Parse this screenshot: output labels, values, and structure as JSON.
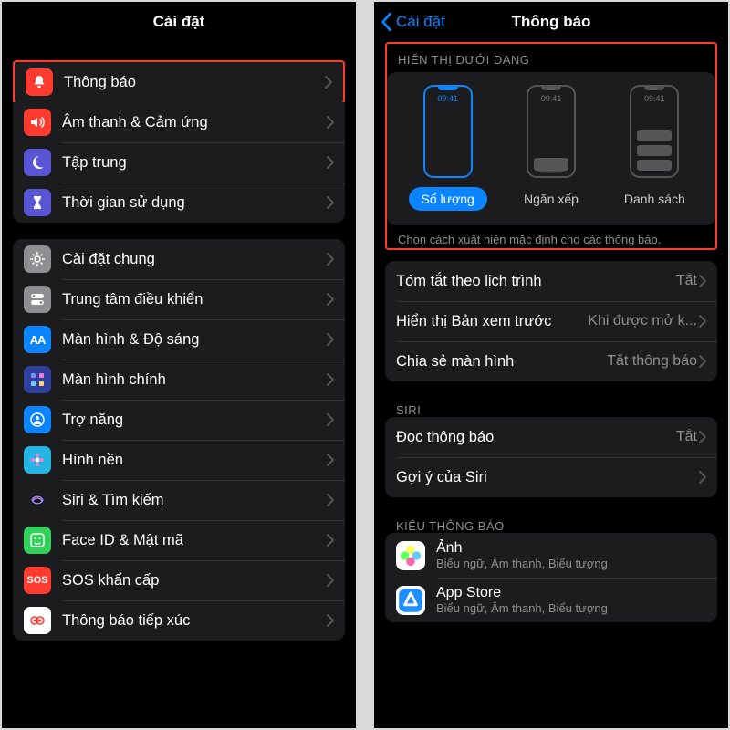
{
  "left": {
    "title": "Cài đặt",
    "group1": [
      {
        "k": "notifications",
        "label": "Thông báo",
        "bg": "#ff3b30",
        "icon": "bell"
      },
      {
        "k": "sounds",
        "label": "Âm thanh & Cảm ứng",
        "bg": "#ff3b30",
        "icon": "speaker"
      },
      {
        "k": "focus",
        "label": "Tập trung",
        "bg": "#5856d6",
        "icon": "moon"
      },
      {
        "k": "screentime",
        "label": "Thời gian sử dụng",
        "bg": "#5856d6",
        "icon": "hourglass"
      }
    ],
    "group2": [
      {
        "k": "general",
        "label": "Cài đặt chung",
        "bg": "#8e8e93",
        "icon": "gear"
      },
      {
        "k": "control",
        "label": "Trung tâm điều khiển",
        "bg": "#8e8e93",
        "icon": "switch"
      },
      {
        "k": "display",
        "label": "Màn hình & Độ sáng",
        "bg": "#0a84ff",
        "icon": "AA"
      },
      {
        "k": "home",
        "label": "Màn hình chính",
        "bg": "#2e3f9d",
        "icon": "grid"
      },
      {
        "k": "accessibility",
        "label": "Trợ năng",
        "bg": "#0a84ff",
        "icon": "person"
      },
      {
        "k": "wallpaper",
        "label": "Hình nền",
        "bg": "#23b6e4",
        "icon": "flower"
      },
      {
        "k": "siri",
        "label": "Siri & Tìm kiếm",
        "bg": "#1c1c1e",
        "icon": "siri"
      },
      {
        "k": "faceid",
        "label": "Face ID & Mật mã",
        "bg": "#30d158",
        "icon": "face"
      },
      {
        "k": "sos",
        "label": "SOS khẩn cấp",
        "bg": "#ff3b30",
        "icon": "SOS"
      },
      {
        "k": "exposure",
        "label": "Thông báo tiếp xúc",
        "bg": "#ffffff",
        "icon": "exposure"
      }
    ]
  },
  "right": {
    "back": "Cài đặt",
    "title": "Thông báo",
    "display_header": "HIỂN THỊ DƯỚI DẠNG",
    "display_time": "09:41",
    "display_options": [
      {
        "k": "count",
        "label": "Số lượng",
        "active": true
      },
      {
        "k": "stack",
        "label": "Ngăn xếp",
        "active": false
      },
      {
        "k": "list",
        "label": "Danh sách",
        "active": false
      }
    ],
    "display_footer": "Chọn cách xuất hiện mặc định cho các thông báo.",
    "rows1": [
      {
        "k": "summary",
        "label": "Tóm tắt theo lịch trình",
        "value": "Tắt"
      },
      {
        "k": "preview",
        "label": "Hiển thị Bản xem trước",
        "value": "Khi được mở k..."
      },
      {
        "k": "share",
        "label": "Chia sẻ màn hình",
        "value": "Tắt thông báo"
      }
    ],
    "siri_header": "SIRI",
    "rows2": [
      {
        "k": "announce",
        "label": "Đọc thông báo",
        "value": "Tắt"
      },
      {
        "k": "suggest",
        "label": "Gợi ý của Siri",
        "value": ""
      }
    ],
    "style_header": "KIỂU THÔNG BÁO",
    "apps": [
      {
        "k": "photos",
        "name": "Ảnh",
        "sub": "Biểu ngữ, Âm thanh, Biểu tượng",
        "icon": "photos"
      },
      {
        "k": "appstore",
        "name": "App Store",
        "sub": "Biểu ngữ, Âm thanh, Biểu tượng",
        "icon": "appstore"
      }
    ]
  }
}
